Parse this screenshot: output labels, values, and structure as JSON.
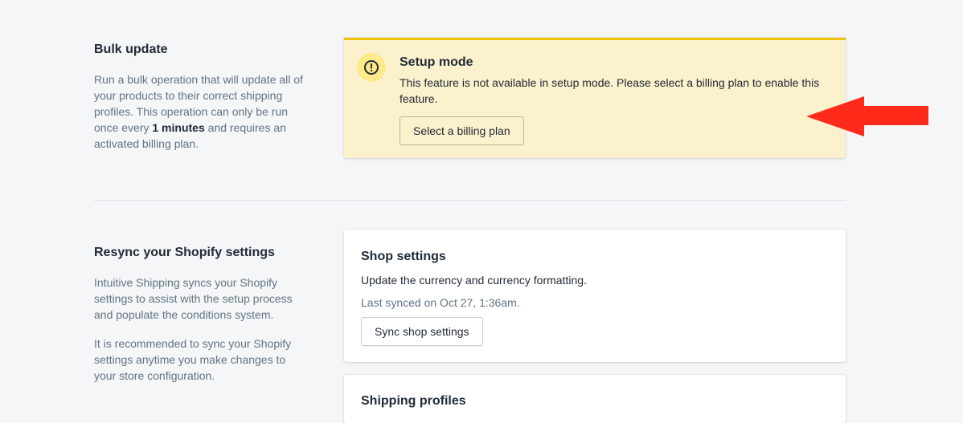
{
  "bulk_update": {
    "title": "Bulk update",
    "description_before": "Run a bulk operation that will update all of your products to their correct shipping profiles. This operation can only be run once every ",
    "description_bold": "1 minutes",
    "description_after": " and requires an activated billing plan."
  },
  "banner": {
    "icon": "exclamation-circle-icon",
    "title": "Setup mode",
    "text": "This feature is not available in setup mode. Please select a billing plan to enable this feature.",
    "button_label": "Select a billing plan",
    "accent_color": "#eec200",
    "background_color": "#fcf1cd"
  },
  "annotation": {
    "icon": "red-arrow-left-icon",
    "color": "#ff2a1a"
  },
  "resync": {
    "title": "Resync your Shopify settings",
    "description_1": "Intuitive Shipping syncs your Shopify settings to assist with the setup process and populate the conditions system.",
    "description_2": "It is recommended to sync your Shopify settings anytime you make changes to your store configuration."
  },
  "shop_settings_card": {
    "title": "Shop settings",
    "text": "Update the currency and currency formatting.",
    "last_synced": "Last synced on Oct 27, 1:36am.",
    "button_label": "Sync shop settings"
  },
  "shipping_profiles_card": {
    "title": "Shipping profiles"
  }
}
